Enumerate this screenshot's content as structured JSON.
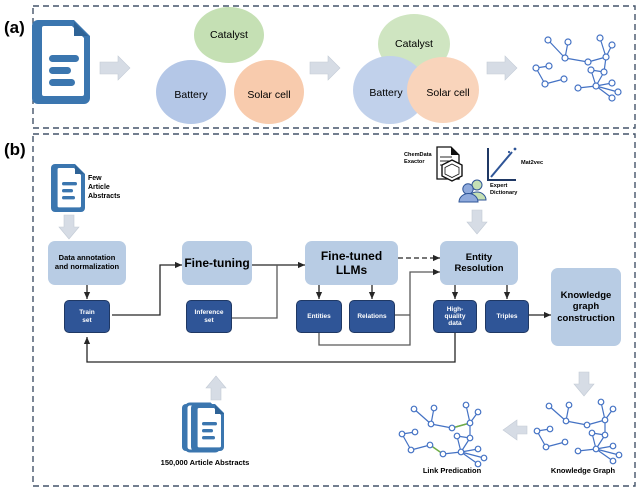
{
  "figure": {
    "panel_a_letter": "(a)",
    "panel_b_letter": "(b)"
  },
  "panel_a": {
    "document_icon": "document-icon",
    "circles": [
      {
        "label": "Catalyst",
        "color": "#c5e0b4"
      },
      {
        "label": "Battery",
        "color": "#b4c7e7"
      },
      {
        "label": "Solar cell",
        "color": "#f8cbad"
      }
    ],
    "venn": [
      {
        "label": "Catalyst",
        "color": "#c5e0b4"
      },
      {
        "label": "Battery",
        "color": "#b4c7e7"
      },
      {
        "label": "Solar cell",
        "color": "#f8cbad"
      }
    ],
    "graph_icon": "knowledge-graph-icon",
    "arrows": [
      "block-arrow-1",
      "block-arrow-2",
      "block-arrow-3"
    ]
  },
  "panel_b": {
    "source_label": "Few\nArticle\nAbstracts",
    "tools": [
      {
        "label": "ChemData\nExactor",
        "icon": "chemdata-extractor-icon"
      },
      {
        "label": "Mat2vec",
        "icon": "mat2vec-chart-icon"
      },
      {
        "label": "Expert\nDictionary",
        "icon": "expert-dictionary-icon"
      }
    ],
    "stages": [
      {
        "id": "data-annotation",
        "label": "Data annotation\nand normalization",
        "size": "small"
      },
      {
        "id": "fine-tuning",
        "label": "Fine-tuning",
        "size": "big"
      },
      {
        "id": "fine-tuned-llms",
        "label": "Fine-tuned\nLLMs",
        "size": "big"
      },
      {
        "id": "entity-resolution",
        "label": "Entity\nResolution",
        "size": "med"
      },
      {
        "id": "kg-construction",
        "label": "Knowledge\ngraph\nconstruction",
        "size": "med"
      }
    ],
    "artifacts": [
      {
        "id": "train-set",
        "label": "Train\nset"
      },
      {
        "id": "inference-set",
        "label": "Inference\nset"
      },
      {
        "id": "entities",
        "label": "Entities"
      },
      {
        "id": "relations",
        "label": "Relations"
      },
      {
        "id": "high-quality-data",
        "label": "High-\nquality\ndata"
      },
      {
        "id": "triples",
        "label": "Triples"
      }
    ],
    "corpus_label": "150,000 Article Abstracts",
    "outputs": [
      {
        "id": "link-predication",
        "label": "Link Predication"
      },
      {
        "id": "knowledge-graph",
        "label": "Knowledge Graph"
      }
    ]
  },
  "colors": {
    "doc_blue": "#3b76af",
    "light_box": "#b8cce4",
    "dark_box": "#2f5597",
    "arrow_grey": "#d6dce5",
    "line": "#262626",
    "node_blue": "#4472c4",
    "link_green": "#70ad47",
    "dash_border": "#44546a"
  }
}
